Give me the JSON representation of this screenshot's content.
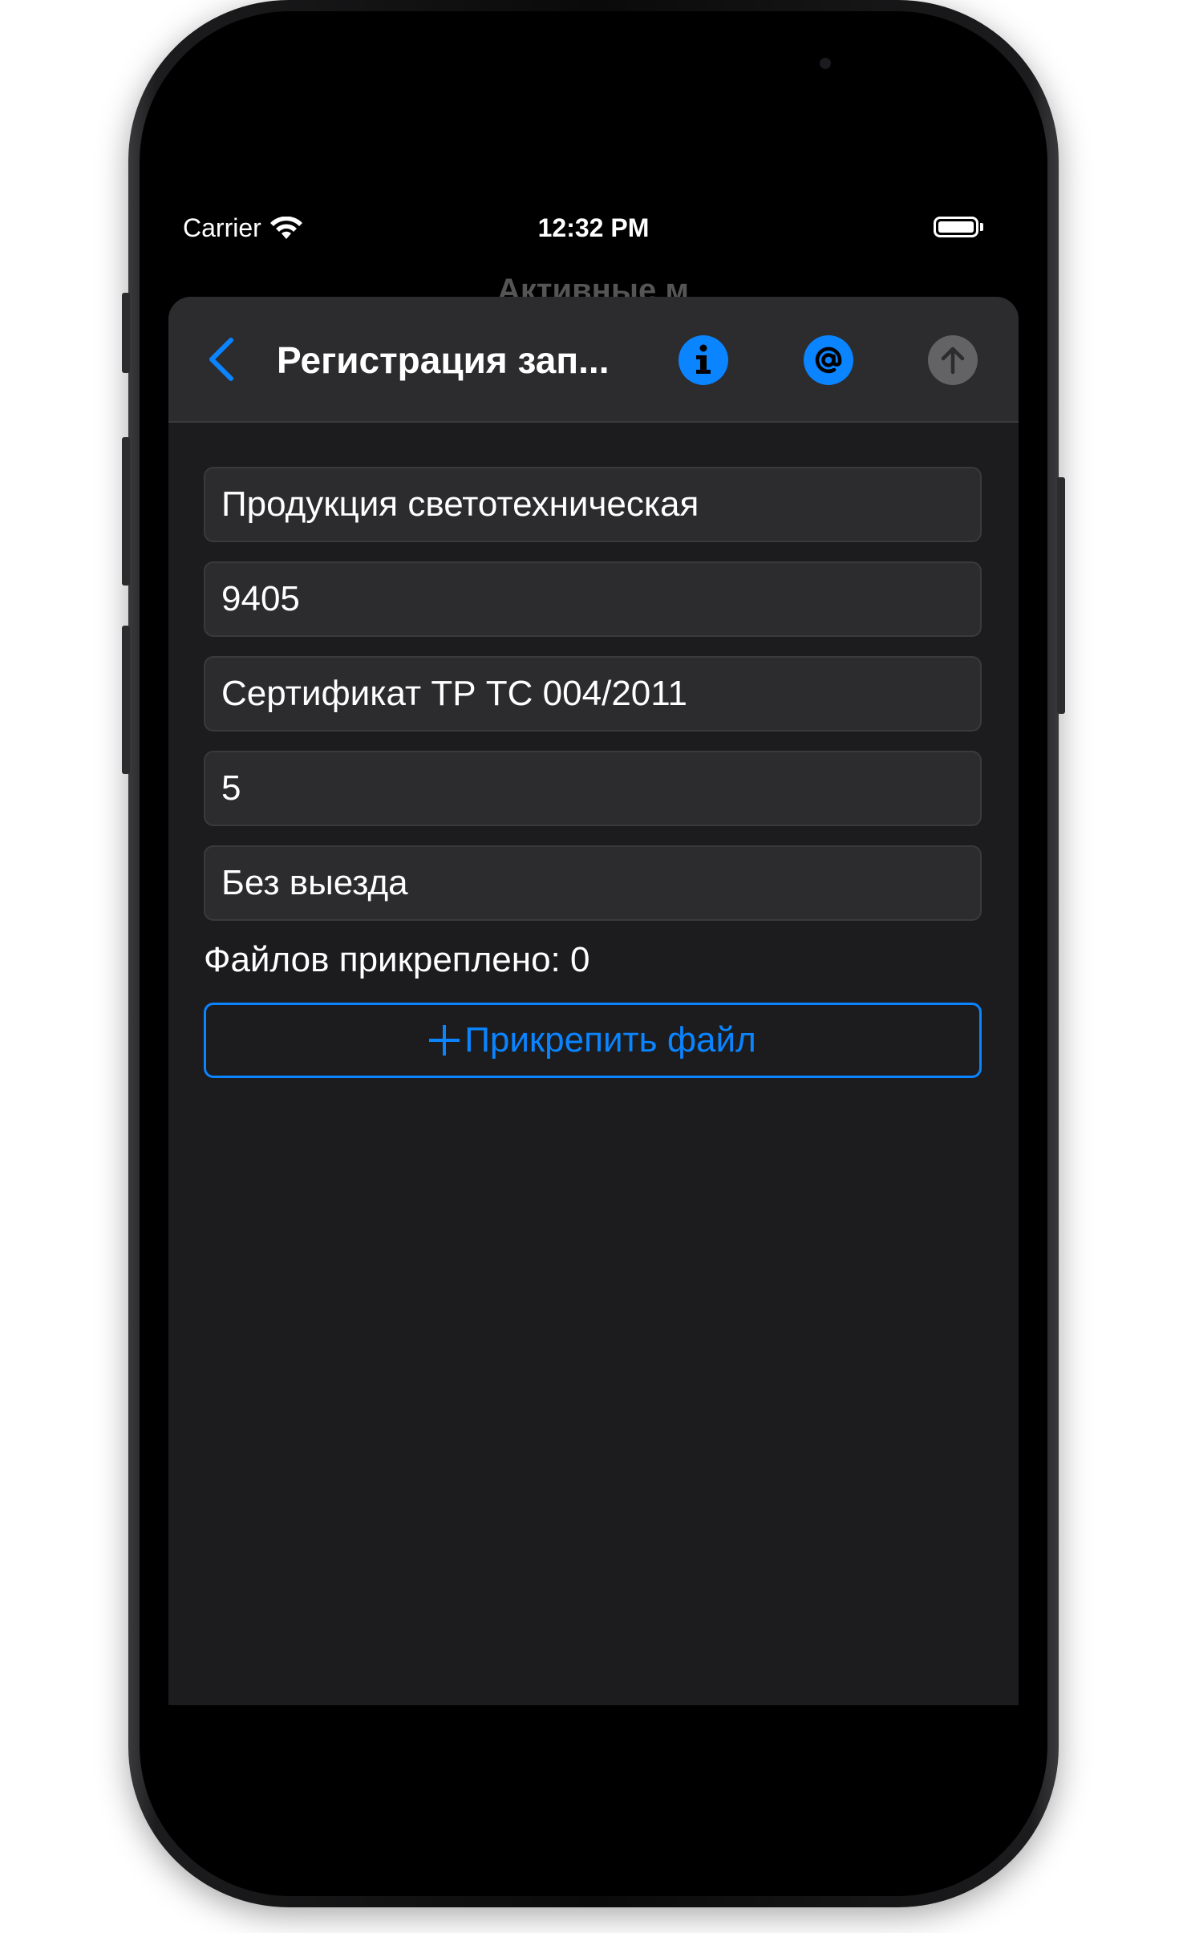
{
  "status_bar": {
    "carrier": "Carrier",
    "time": "12:32 PM"
  },
  "background_title": "Активные м",
  "navbar": {
    "title": "Регистрация зап...",
    "info_icon": "info-icon",
    "at_icon": "at-icon",
    "upload_icon": "arrow-up-icon",
    "accent_color": "#0A84FF",
    "disabled_color": "#636366"
  },
  "form": {
    "fields": [
      {
        "value": "Продукция светотехническая"
      },
      {
        "value": "9405"
      },
      {
        "value": "Сертификат ТР ТС 004/2011"
      },
      {
        "value": "5"
      },
      {
        "value": "Без выезда"
      }
    ],
    "files_label": "Файлов прикреплено: 0",
    "attach_label": "Прикрепить файл"
  }
}
